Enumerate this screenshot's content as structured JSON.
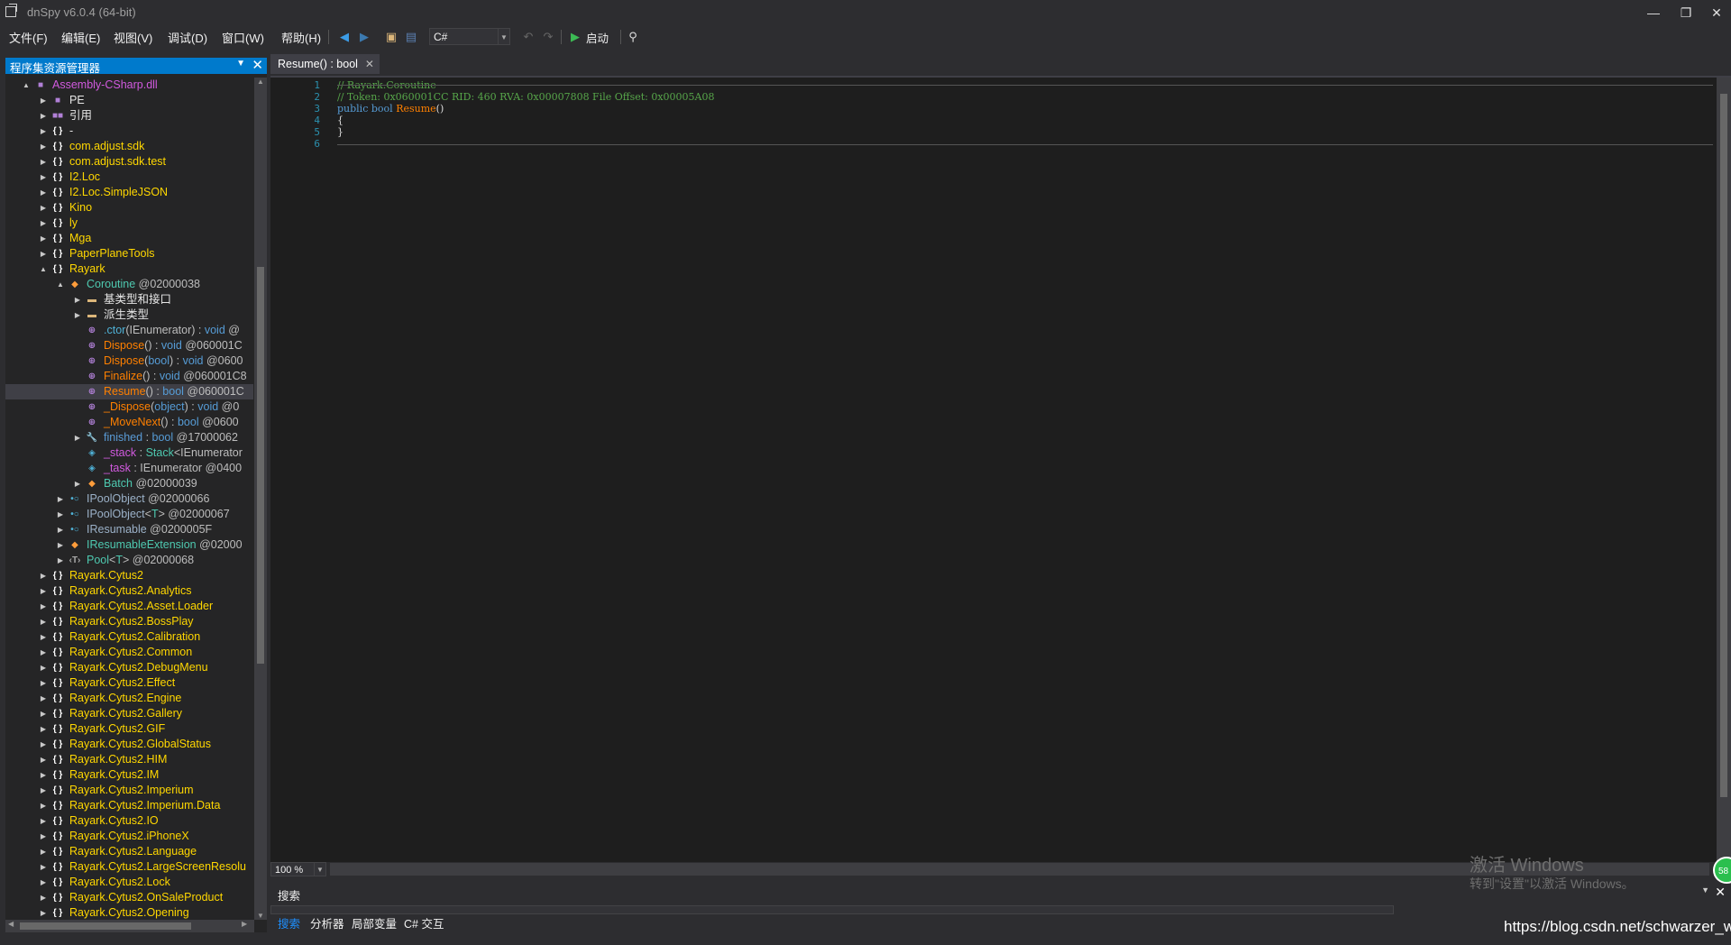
{
  "window": {
    "title": "dnSpy v6.0.4 (64-bit)",
    "minimize": "—",
    "restore": "❐",
    "close": "✕"
  },
  "menu": {
    "items": [
      "文件(F)",
      "编辑(E)",
      "视图(V)",
      "调试(D)",
      "窗口(W)",
      "帮助(H)"
    ],
    "language": "C#",
    "start_label": "启动"
  },
  "explorer": {
    "title": "程序集资源管理器",
    "rows": [
      {
        "exp": "▲",
        "icon": "■",
        "cls": "c-asm",
        "text": "Assembly-CSharp.dll"
      },
      {
        "exp": "▶",
        "icon": "■",
        "cls": "c-white",
        "text": "PE"
      },
      {
        "exp": "▶",
        "icon": "■■",
        "cls": "c-white",
        "text": "引用"
      },
      {
        "exp": "▶",
        "icon": "{ }",
        "cls": "c-white",
        "text": "-"
      },
      {
        "exp": "▶",
        "icon": "{ }",
        "cls": "c-ns",
        "text": "com.adjust.sdk"
      },
      {
        "exp": "▶",
        "icon": "{ }",
        "cls": "c-ns",
        "text": "com.adjust.sdk.test"
      },
      {
        "exp": "▶",
        "icon": "{ }",
        "cls": "c-ns",
        "text": "I2.Loc"
      },
      {
        "exp": "▶",
        "icon": "{ }",
        "cls": "c-ns",
        "text": "I2.Loc.SimpleJSON"
      },
      {
        "exp": "▶",
        "icon": "{ }",
        "cls": "c-ns",
        "text": "Kino"
      },
      {
        "exp": "▶",
        "icon": "{ }",
        "cls": "c-ns",
        "text": "ly"
      },
      {
        "exp": "▶",
        "icon": "{ }",
        "cls": "c-ns",
        "text": "Mga"
      },
      {
        "exp": "▶",
        "icon": "{ }",
        "cls": "c-ns",
        "text": "PaperPlaneTools"
      },
      {
        "exp": "▲",
        "icon": "{ }",
        "cls": "c-ns",
        "text": "Rayark"
      },
      {
        "exp": "▲",
        "icon": "◆",
        "cls": "c-type",
        "text": "Coroutine",
        "suffix": " @02000038"
      },
      {
        "exp": "▶",
        "icon": "▬",
        "cls": "c-white",
        "text": "基类型和接口"
      },
      {
        "exp": "▶",
        "icon": "▬",
        "cls": "c-white",
        "text": "派生类型"
      },
      {
        "exp": "",
        "icon": "⊕",
        "cls": "c-ctor",
        "text": ".ctor",
        "parts": [
          [
            "c-ctor",
            ".ctor"
          ],
          [
            "c-gray",
            "(IEnumerator) : "
          ],
          [
            "c-kw",
            "void"
          ],
          [
            "c-gray",
            " @"
          ]
        ]
      },
      {
        "exp": "",
        "icon": "⊕",
        "cls": "c-method",
        "text": "Dispose",
        "parts": [
          [
            "c-method",
            "Dispose"
          ],
          [
            "c-gray",
            "() : "
          ],
          [
            "c-kw",
            "void"
          ],
          [
            "c-gray",
            " @060001C"
          ]
        ]
      },
      {
        "exp": "",
        "icon": "⊕",
        "cls": "c-method",
        "text": "Dispose",
        "parts": [
          [
            "c-method",
            "Dispose"
          ],
          [
            "c-gray",
            "("
          ],
          [
            "c-kw",
            "bool"
          ],
          [
            "c-gray",
            ") : "
          ],
          [
            "c-kw",
            "void"
          ],
          [
            "c-gray",
            " @0600"
          ]
        ]
      },
      {
        "exp": "",
        "icon": "⊕",
        "cls": "c-method",
        "text": "Finalize",
        "parts": [
          [
            "c-method",
            "Finalize"
          ],
          [
            "c-gray",
            "() : "
          ],
          [
            "c-kw",
            "void"
          ],
          [
            "c-gray",
            " @060001C8"
          ]
        ]
      },
      {
        "exp": "",
        "icon": "⊕",
        "cls": "c-method",
        "text": "Resume",
        "selected": true,
        "parts": [
          [
            "c-method",
            "Resume"
          ],
          [
            "c-gray",
            "() : "
          ],
          [
            "c-kw",
            "bool"
          ],
          [
            "c-gray",
            " @060001C"
          ]
        ]
      },
      {
        "exp": "",
        "icon": "⊕",
        "cls": "c-method",
        "text": "_Dispose",
        "parts": [
          [
            "c-method",
            "_Dispose"
          ],
          [
            "c-gray",
            "("
          ],
          [
            "c-kw",
            "object"
          ],
          [
            "c-gray",
            ") : "
          ],
          [
            "c-kw",
            "void"
          ],
          [
            "c-gray",
            " @0"
          ]
        ]
      },
      {
        "exp": "",
        "icon": "⊕",
        "cls": "c-method",
        "text": "_MoveNext",
        "parts": [
          [
            "c-method",
            "_MoveNext"
          ],
          [
            "c-gray",
            "() : "
          ],
          [
            "c-kw",
            "bool"
          ],
          [
            "c-gray",
            " @0600"
          ]
        ]
      },
      {
        "exp": "▶",
        "icon": "🔧",
        "cls": "c-prop",
        "text": "finished",
        "parts": [
          [
            "c-prop",
            "finished"
          ],
          [
            "c-gray",
            " : "
          ],
          [
            "c-kw",
            "bool"
          ],
          [
            "c-gray",
            " @17000062"
          ]
        ]
      },
      {
        "exp": "",
        "icon": "◈",
        "cls": "c-field",
        "text": "_stack",
        "parts": [
          [
            "c-field",
            "_stack"
          ],
          [
            "c-gray",
            " : "
          ],
          [
            "c-type",
            "Stack"
          ],
          [
            "c-gray",
            "<IEnumerator"
          ]
        ]
      },
      {
        "exp": "",
        "icon": "◈",
        "cls": "c-field",
        "text": "_task",
        "parts": [
          [
            "c-field",
            "_task"
          ],
          [
            "c-gray",
            " : IEnumerator @0400"
          ]
        ]
      },
      {
        "exp": "▶",
        "icon": "◆",
        "cls": "c-type",
        "text": "Batch",
        "suffix": " @02000039"
      },
      {
        "exp": "▶",
        "icon": "•○",
        "cls": "c-iface",
        "text": "IPoolObject",
        "suffix": " @02000066"
      },
      {
        "exp": "▶",
        "icon": "•○",
        "cls": "c-iface",
        "text": "IPoolObject",
        "parts": [
          [
            "c-iface",
            "IPoolObject"
          ],
          [
            "c-gray",
            "<"
          ],
          [
            "c-gen",
            "T"
          ],
          [
            "c-gray",
            "> @02000067"
          ]
        ]
      },
      {
        "exp": "▶",
        "icon": "•○",
        "cls": "c-iface",
        "text": "IResumable",
        "suffix": " @0200005F"
      },
      {
        "exp": "▶",
        "icon": "◆",
        "cls": "c-type",
        "text": "IResumableExtension",
        "parts": [
          [
            "c-type",
            "IResumableExtension"
          ],
          [
            "c-gray",
            " @02000"
          ]
        ]
      },
      {
        "exp": "▶",
        "icon": "‹T›",
        "cls": "c-type",
        "text": "Pool",
        "parts": [
          [
            "c-type",
            "Pool"
          ],
          [
            "c-gray",
            "<"
          ],
          [
            "c-gen",
            "T"
          ],
          [
            "c-gray",
            "> @02000068"
          ]
        ]
      },
      {
        "exp": "▶",
        "icon": "{ }",
        "cls": "c-ns",
        "text": "Rayark.Cytus2"
      },
      {
        "exp": "▶",
        "icon": "{ }",
        "cls": "c-ns",
        "text": "Rayark.Cytus2.Analytics"
      },
      {
        "exp": "▶",
        "icon": "{ }",
        "cls": "c-ns",
        "text": "Rayark.Cytus2.Asset.Loader"
      },
      {
        "exp": "▶",
        "icon": "{ }",
        "cls": "c-ns",
        "text": "Rayark.Cytus2.BossPlay"
      },
      {
        "exp": "▶",
        "icon": "{ }",
        "cls": "c-ns",
        "text": "Rayark.Cytus2.Calibration"
      },
      {
        "exp": "▶",
        "icon": "{ }",
        "cls": "c-ns",
        "text": "Rayark.Cytus2.Common"
      },
      {
        "exp": "▶",
        "icon": "{ }",
        "cls": "c-ns",
        "text": "Rayark.Cytus2.DebugMenu"
      },
      {
        "exp": "▶",
        "icon": "{ }",
        "cls": "c-ns",
        "text": "Rayark.Cytus2.Effect"
      },
      {
        "exp": "▶",
        "icon": "{ }",
        "cls": "c-ns",
        "text": "Rayark.Cytus2.Engine"
      },
      {
        "exp": "▶",
        "icon": "{ }",
        "cls": "c-ns",
        "text": "Rayark.Cytus2.Gallery"
      },
      {
        "exp": "▶",
        "icon": "{ }",
        "cls": "c-ns",
        "text": "Rayark.Cytus2.GIF"
      },
      {
        "exp": "▶",
        "icon": "{ }",
        "cls": "c-ns",
        "text": "Rayark.Cytus2.GlobalStatus"
      },
      {
        "exp": "▶",
        "icon": "{ }",
        "cls": "c-ns",
        "text": "Rayark.Cytus2.HIM"
      },
      {
        "exp": "▶",
        "icon": "{ }",
        "cls": "c-ns",
        "text": "Rayark.Cytus2.IM"
      },
      {
        "exp": "▶",
        "icon": "{ }",
        "cls": "c-ns",
        "text": "Rayark.Cytus2.Imperium"
      },
      {
        "exp": "▶",
        "icon": "{ }",
        "cls": "c-ns",
        "text": "Rayark.Cytus2.Imperium.Data"
      },
      {
        "exp": "▶",
        "icon": "{ }",
        "cls": "c-ns",
        "text": "Rayark.Cytus2.IO"
      },
      {
        "exp": "▶",
        "icon": "{ }",
        "cls": "c-ns",
        "text": "Rayark.Cytus2.iPhoneX"
      },
      {
        "exp": "▶",
        "icon": "{ }",
        "cls": "c-ns",
        "text": "Rayark.Cytus2.Language"
      },
      {
        "exp": "▶",
        "icon": "{ }",
        "cls": "c-ns",
        "text": "Rayark.Cytus2.LargeScreenResolu"
      },
      {
        "exp": "▶",
        "icon": "{ }",
        "cls": "c-ns",
        "text": "Rayark.Cytus2.Lock"
      },
      {
        "exp": "▶",
        "icon": "{ }",
        "cls": "c-ns",
        "text": "Rayark.Cytus2.OnSaleProduct"
      },
      {
        "exp": "▶",
        "icon": "{ }",
        "cls": "c-ns",
        "text": "Rayark.Cytus2.Opening"
      }
    ]
  },
  "editor": {
    "tab_title": "Resume() : bool",
    "zoom": "100 %",
    "lines": [
      {
        "n": "1",
        "parts": [
          [
            "cl-comment",
            "// Rayark.Coroutine"
          ]
        ]
      },
      {
        "n": "2",
        "parts": [
          [
            "cl-comment",
            "// Token: 0x060001CC RID: 460 RVA: 0x00007808 File Offset: 0x00005A08"
          ]
        ]
      },
      {
        "n": "3",
        "parts": [
          [
            "cl-kw",
            "public"
          ],
          [
            "cl-plain",
            " "
          ],
          [
            "cl-kw",
            "bool"
          ],
          [
            "cl-plain",
            " "
          ],
          [
            "cl-name",
            "Resume"
          ],
          [
            "cl-plain",
            "()"
          ]
        ]
      },
      {
        "n": "4",
        "parts": [
          [
            "cl-plain",
            "{"
          ]
        ]
      },
      {
        "n": "5",
        "parts": [
          [
            "cl-plain",
            "}"
          ]
        ]
      },
      {
        "n": "6",
        "parts": []
      }
    ]
  },
  "bottom": {
    "panel_title": "搜索",
    "tabs": [
      "搜索",
      "分析器",
      "局部变量",
      "C# 交互"
    ]
  },
  "watermark": {
    "line1": "激活 Windows",
    "line2": "转到\"设置\"以激活 Windows。",
    "url": "https://blog.csdn.net/schwarzer_w",
    "badge": "58"
  }
}
